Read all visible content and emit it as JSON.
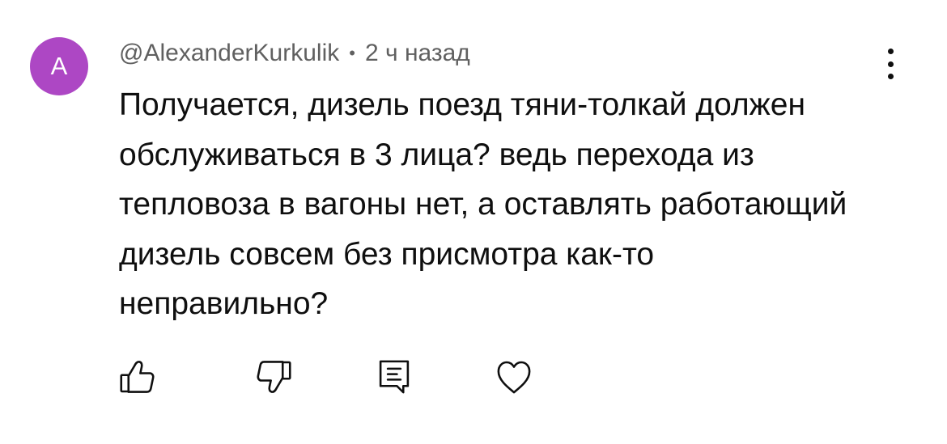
{
  "comment": {
    "avatar_letter": "A",
    "avatar_color": "#ad47c4",
    "author": "@AlexanderKurkulik",
    "separator": "•",
    "time_ago": "2 ч назад",
    "text": "Получается, дизель поезд тяни-толкай должен обслуживаться в 3 лица? ведь перехода из тепловоза в вагоны нет, а оставлять работающий дизель совсем без присмотра как-то неправильно?"
  },
  "actions": {
    "icons": [
      "thumbs-up-icon",
      "thumbs-down-icon",
      "reply-icon",
      "heart-icon"
    ]
  },
  "menu": {
    "icon": "more-vertical-icon"
  }
}
